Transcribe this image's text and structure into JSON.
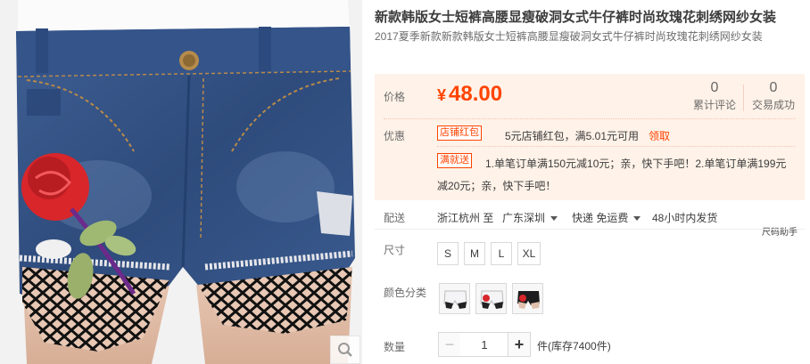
{
  "product": {
    "title": "新款韩版女士短裤高腰显瘦破洞女式牛仔裤时尚玫瑰花刺绣网纱女装",
    "subtitle": "2017夏季新款新款韩版女士短裤高腰显瘦破洞女式牛仔裤时尚玫瑰花刺绣网纱女装",
    "image_icon": "denim-shorts-photo",
    "zoom_icon": "magnifier-icon"
  },
  "price": {
    "label": "价格",
    "currency": "¥",
    "value": "48.00",
    "accent_color": "#ff4400",
    "background": "#fff2e8"
  },
  "stats": {
    "reviews_count": "0",
    "reviews_label": "累计评论",
    "sold_count": "0",
    "sold_label": "交易成功"
  },
  "promo": {
    "label": "优惠",
    "tag1": "店铺红包",
    "text1": "5元店铺红包，满5.01元可用",
    "claim": "领取",
    "tag2": "满就送",
    "text2_line1": "1.单笔订单满150元减10元；亲，快下手吧！2.单笔订单满199元",
    "text2_line2": "减20元；亲，快下手吧！"
  },
  "shipping": {
    "label": "配送",
    "from": "浙江杭州 至",
    "to": "广东深圳",
    "method": "快递 免运费",
    "dispatch": "48小时内发货",
    "size_helper": "尺码助手"
  },
  "size": {
    "label": "尺寸",
    "options": [
      "S",
      "M",
      "L",
      "XL"
    ]
  },
  "color": {
    "label": "颜色分类",
    "options": [
      "white-shorts-thumb",
      "rose-shorts-thumb",
      "black-shorts-thumb"
    ]
  },
  "quantity": {
    "label": "数量",
    "value": "1",
    "minus": "−",
    "plus": "+",
    "stock": "件(库存7400件)"
  }
}
